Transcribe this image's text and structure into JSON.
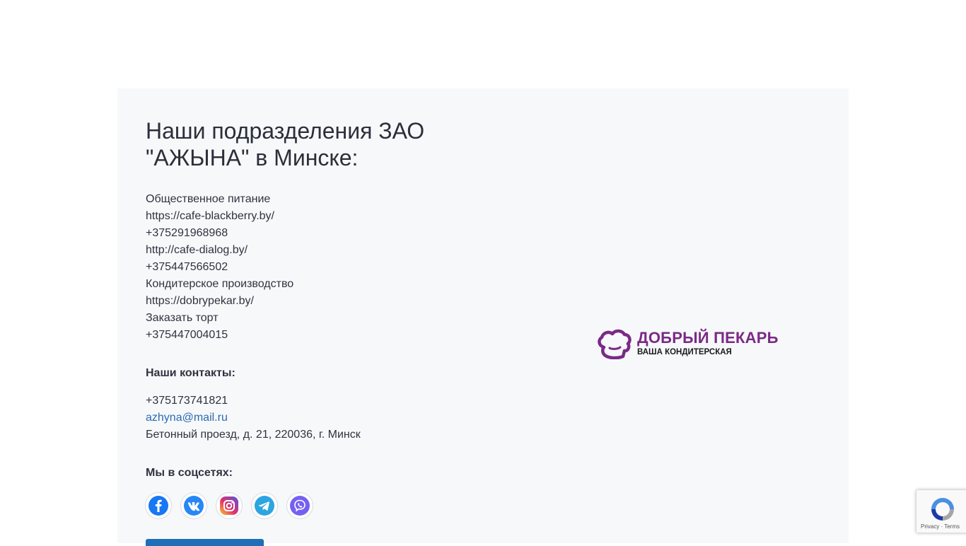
{
  "title": "Наши подразделения ЗАО \"АЖЫНА\" в Минске:",
  "divisions": [
    "Общественное питание",
    "https://cafe-blackberry.by/",
    "+375291968968",
    "http://cafe-dialog.by/",
    "+375447566502",
    "Кондитерское производство",
    "https://dobrypekar.by/",
    "Заказать торт",
    "+375447004015"
  ],
  "contacts": {
    "heading": "Наши контакты:",
    "phone": "+375173741821",
    "email": "azhyna@mail.ru",
    "address": "Бетонный проезд, д. 21, 220036, г. Минск"
  },
  "social": {
    "heading": "Мы в соцсетях:",
    "icons": [
      "facebook-icon",
      "vk-icon",
      "instagram-icon",
      "telegram-icon",
      "viber-icon"
    ]
  },
  "logo": {
    "name": "ДОБРЫЙ ПЕКАРЬ",
    "tagline": "ВАША КОНДИТЕРСКАЯ",
    "color": "#7a2a86"
  },
  "recaptcha": {
    "privacy": "Privacy",
    "terms": "Terms"
  }
}
